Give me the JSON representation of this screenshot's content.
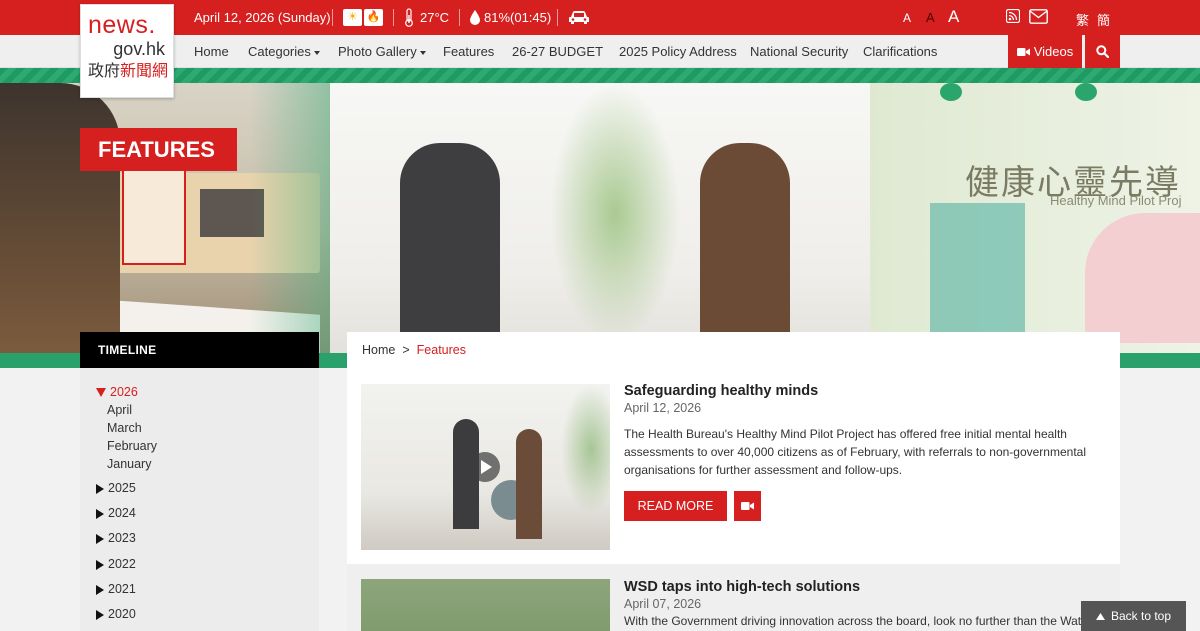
{
  "topbar": {
    "date": "April 12, 2026 (Sunday)",
    "temperature": "27°C",
    "humidity": "81%(01:45)",
    "font_small": "A",
    "font_medium": "A",
    "font_large": "A",
    "lang_tc": "繁",
    "lang_sc": "簡"
  },
  "logo": {
    "line1": "news.",
    "line2": "gov.hk",
    "line3_part1": "政府",
    "line3_part2": "新聞網"
  },
  "nav": {
    "items": [
      {
        "label": "Home"
      },
      {
        "label": "Categories"
      },
      {
        "label": "Photo Gallery"
      },
      {
        "label": "Features"
      },
      {
        "label": "26-27 BUDGET"
      },
      {
        "label": "2025 Policy Address"
      },
      {
        "label": "National Security"
      },
      {
        "label": "Clarifications"
      }
    ],
    "videos_label": "Videos"
  },
  "hero": {
    "badge": "FEATURES",
    "sign_cn": "健康心靈先導",
    "sign_en": "Healthy Mind Pilot Proj"
  },
  "sidebar": {
    "heading": "TIMELINE",
    "years": [
      {
        "label": "2026",
        "open": true,
        "months": [
          "April",
          "March",
          "February",
          "January"
        ]
      },
      {
        "label": "2025"
      },
      {
        "label": "2024"
      },
      {
        "label": "2023"
      },
      {
        "label": "2022"
      },
      {
        "label": "2021"
      },
      {
        "label": "2020"
      }
    ]
  },
  "breadcrumb": {
    "home": "Home",
    "sep": ">",
    "current": "Features"
  },
  "articles": [
    {
      "title": "Safeguarding healthy minds",
      "date": "April 12, 2026",
      "summary": "The Health Bureau's Healthy Mind Pilot Project has offered free initial mental health assessments to over 40,000 citizens as of February, with referrals to non-governmental organisations for further assessment and follow-ups.",
      "read_more": "READ MORE"
    },
    {
      "title": "WSD taps into high-tech solutions",
      "date": "April 07, 2026",
      "summary": "With the Government driving innovation across the board, look no further than the Wate"
    }
  ],
  "back_to_top": "Back to top",
  "colors": {
    "brand_red": "#d6201f",
    "green": "#2aa06a"
  }
}
